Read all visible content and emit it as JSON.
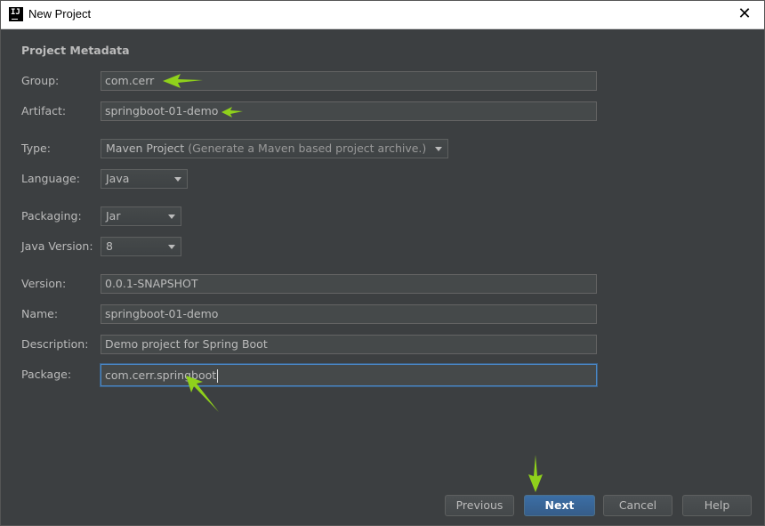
{
  "window": {
    "title": "New Project",
    "app_icon": "intellij-icon",
    "close_icon": "close-icon"
  },
  "section_title": "Project Metadata",
  "fields": {
    "group": {
      "label": "Group:",
      "value": "com.cerr"
    },
    "artifact": {
      "label": "Artifact:",
      "value": "springboot-01-demo"
    },
    "type": {
      "label": "Type:",
      "value": "Maven Project",
      "hint": "(Generate a Maven based project archive.)"
    },
    "language": {
      "label": "Language:",
      "value": "Java"
    },
    "packaging": {
      "label": "Packaging:",
      "value": "Jar"
    },
    "java_version": {
      "label": "Java Version:",
      "value": "8"
    },
    "version": {
      "label": "Version:",
      "value": "0.0.1-SNAPSHOT"
    },
    "name": {
      "label": "Name:",
      "value": "springboot-01-demo"
    },
    "description": {
      "label": "Description:",
      "value": "Demo project for Spring Boot"
    },
    "package": {
      "label": "Package:",
      "value": "com.cerr.springboot"
    }
  },
  "buttons": {
    "previous": "Previous",
    "next": "Next",
    "cancel": "Cancel",
    "help": "Help"
  },
  "colors": {
    "background": "#3c3f41",
    "field_bg": "#45494a",
    "focus_border": "#4a88c7",
    "primary_button": "#365d89",
    "annotation_arrow": "#8fd11b"
  }
}
